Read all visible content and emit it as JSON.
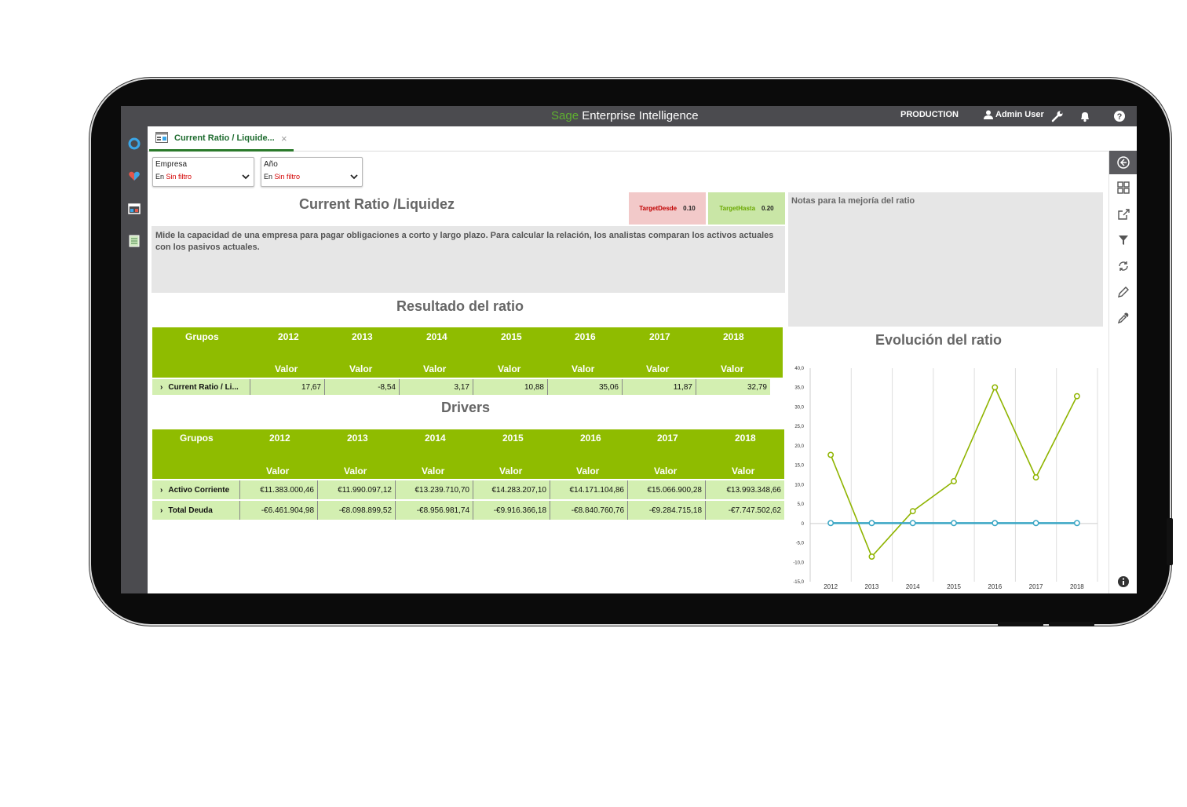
{
  "topbar": {
    "brand": "Sage",
    "title": "Enterprise Intelligence",
    "environment": "PRODUCTION",
    "user": "Admin User"
  },
  "tab": {
    "label": "Current Ratio / Liquide...",
    "close": "×"
  },
  "filters": [
    {
      "label": "Empresa",
      "prefix": "En",
      "value": "Sin filtro"
    },
    {
      "label": "Año",
      "prefix": "En",
      "value": "Sin filtro"
    }
  ],
  "main": {
    "title": "Current Ratio /Liquidez",
    "description": "Mide la capacidad de una empresa para pagar obligaciones a corto y largo plazo. Para calcular la relación, los analistas comparan los activos actuales con los pasivos actuales.",
    "target_from": {
      "label": "TargetDesde",
      "value": "0.10",
      "color": "#f2c9c9",
      "text_color": "#c00000"
    },
    "target_to": {
      "label": "TargetHasta",
      "value": "0.20",
      "color": "#c9e6a6",
      "text_color": "#6aa800"
    },
    "notes_title": "Notas para la mejoría del ratio",
    "result_title": "Resultado del ratio",
    "drivers_title": "Drivers",
    "evolution_title": "Evolución del ratio"
  },
  "result_table": {
    "group_header": "Grupos",
    "years": [
      "2012",
      "2013",
      "2014",
      "2015",
      "2016",
      "2017",
      "2018"
    ],
    "value_header": "Valor",
    "rows": [
      {
        "label": "Current Ratio / Li...",
        "values": [
          "17,67",
          "-8,54",
          "3,17",
          "10,88",
          "35,06",
          "11,87",
          "32,79"
        ]
      }
    ]
  },
  "drivers_table": {
    "group_header": "Grupos",
    "years": [
      "2012",
      "2013",
      "2014",
      "2015",
      "2016",
      "2017",
      "2018"
    ],
    "value_header": "Valor",
    "rows": [
      {
        "label": "Activo Corriente",
        "values": [
          "€11.383.000,46",
          "€11.990.097,12",
          "€13.239.710,70",
          "€14.283.207,10",
          "€14.171.104,86",
          "€15.066.900,28",
          "€13.993.348,66"
        ]
      },
      {
        "label": "Total Deuda",
        "values": [
          "-€6.461.904,98",
          "-€8.098.899,52",
          "-€8.956.981,74",
          "-€9.916.366,18",
          "-€8.840.760,76",
          "-€9.284.715,18",
          "-€7.747.502,62"
        ]
      }
    ]
  },
  "chart_data": {
    "type": "line",
    "x": [
      "2012",
      "2013",
      "2014",
      "2015",
      "2016",
      "2017",
      "2018"
    ],
    "y_ticks": [
      "40,0",
      "35,0",
      "30,0",
      "25,0",
      "20,0",
      "15,0",
      "10,0",
      "5,0",
      "0",
      "-5,0",
      "-10,0",
      "-15,0"
    ],
    "ylim": [
      -15,
      40
    ],
    "grid": "vertical",
    "series": [
      {
        "values": [
          17.67,
          -8.54,
          3.17,
          10.88,
          35.06,
          11.87,
          32.79
        ],
        "color": "#8fb400"
      },
      {
        "values": [
          0.1,
          0.1,
          0.1,
          0.1,
          0.1,
          0.1,
          0.1
        ],
        "color": "#3aa6c4"
      }
    ]
  }
}
